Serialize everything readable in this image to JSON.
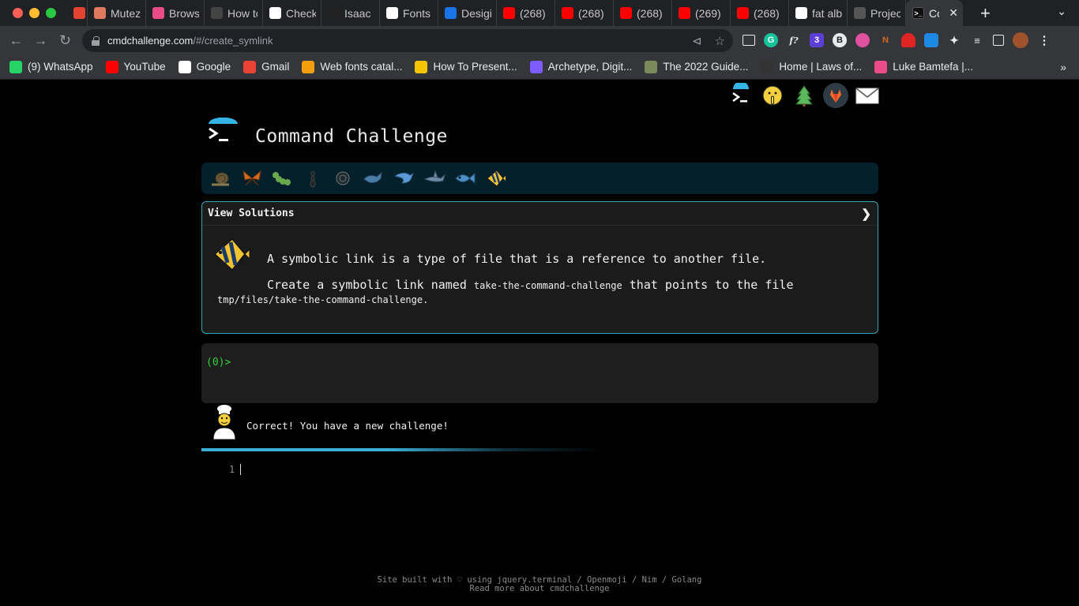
{
  "browser": {
    "tabs": [
      {
        "label": "",
        "icon": "todoist-icon",
        "color": "#e44332"
      },
      {
        "label": "Mutez",
        "icon": "m-icon",
        "color": "#e07a5f"
      },
      {
        "label": "Brows",
        "icon": "dribbble-icon",
        "color": "#ea4c89"
      },
      {
        "label": "How tc",
        "icon": "github-icon",
        "color": "#444444"
      },
      {
        "label": "Check",
        "icon": "check-icon",
        "color": "#ffffff"
      },
      {
        "label": "Isaac I",
        "icon": "spider-icon",
        "color": "#222222"
      },
      {
        "label": "Fonts",
        "icon": "sheets-icon",
        "color": "#ffffff"
      },
      {
        "label": "Desigi",
        "icon": "layers-icon",
        "color": "#1a73e8"
      },
      {
        "label": "(268)",
        "icon": "youtube-icon",
        "color": "#ff0000"
      },
      {
        "label": "(268)",
        "icon": "youtube-icon",
        "color": "#ff0000"
      },
      {
        "label": "(268)",
        "icon": "youtube-icon",
        "color": "#ff0000"
      },
      {
        "label": "(269)",
        "icon": "youtube-icon",
        "color": "#ff0000"
      },
      {
        "label": "(268)",
        "icon": "youtube-icon",
        "color": "#ff0000"
      },
      {
        "label": "fat alb",
        "icon": "google-icon",
        "color": "#ffffff"
      },
      {
        "label": "Projec",
        "icon": "project-icon",
        "color": "#555555"
      }
    ],
    "active_tab": {
      "label": "Co"
    },
    "url_host": "cmdchallenge.com",
    "url_path": "/#/create_symlink",
    "bookmarks": [
      {
        "label": "(9) WhatsApp",
        "icon": "whatsapp-icon",
        "color": "#25d366"
      },
      {
        "label": "YouTube",
        "icon": "youtube-icon",
        "color": "#ff0000"
      },
      {
        "label": "Google",
        "icon": "google-icon",
        "color": "#ffffff"
      },
      {
        "label": "Gmail",
        "icon": "gmail-icon",
        "color": "#ea4335"
      },
      {
        "label": "Web fonts catal...",
        "icon": "fh-icon",
        "color": "#f59e0b"
      },
      {
        "label": "How To Present...",
        "icon": "bookmark-c-icon",
        "color": "#f5c400"
      },
      {
        "label": "Archetype, Digit...",
        "icon": "archetype-icon",
        "color": "#7c5cff"
      },
      {
        "label": "The 2022 Guide...",
        "icon": "d-icon",
        "color": "#7a8a5a"
      },
      {
        "label": "Home | Laws of...",
        "icon": "laws-icon",
        "color": "#333333"
      },
      {
        "label": "Luke Bamtefa |...",
        "icon": "dribbble-icon",
        "color": "#ea4c89"
      }
    ]
  },
  "page": {
    "title": "Command Challenge",
    "challenge": {
      "header": "View Solutions",
      "line1": "A symbolic link is a type of file that is a reference to another file.",
      "line2_prefix": "Create a symbolic link named ",
      "line2_code": "take-the-command-challenge",
      "line2_suffix": " that points to the file",
      "line3": "tmp/files/take-the-command-challenge."
    },
    "prompt": "(0)>",
    "result_message": "Correct! You have a new challenge!",
    "editor_line_number": "1",
    "footer_line1": "Site built with ♡ using jquery.terminal / Openmoji / Nim / Golang",
    "footer_line2": "Read more about cmdchallenge",
    "progress_fraction": 0.46
  }
}
